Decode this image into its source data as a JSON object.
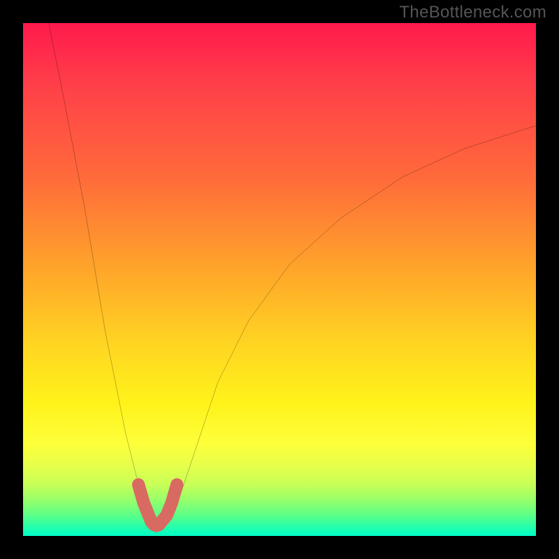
{
  "watermark": "TheBottleneck.com",
  "chart_data": {
    "type": "line",
    "title": "",
    "xlabel": "",
    "ylabel": "",
    "xlim": [
      0,
      100
    ],
    "ylim": [
      0,
      100
    ],
    "grid": false,
    "series": [
      {
        "name": "main-curve",
        "color": "#000000",
        "x": [
          5,
          8,
          12,
          16,
          18,
          20,
          22,
          24,
          25,
          26,
          27,
          28,
          30,
          32,
          34,
          38,
          44,
          52,
          62,
          74,
          86,
          100
        ],
        "y": [
          100,
          85,
          64,
          40,
          30,
          20,
          12,
          6,
          3,
          2,
          2,
          3,
          6,
          12,
          18,
          30,
          42,
          53,
          62,
          70,
          75.5,
          80
        ]
      },
      {
        "name": "threshold-band",
        "color": "#d86a62",
        "x": [
          22.5,
          23.5,
          24.5,
          25.0,
          25.5,
          26.0,
          26.5,
          27.0,
          28.0,
          29.0,
          30.0
        ],
        "y": [
          10.0,
          6.5,
          4.0,
          2.8,
          2.2,
          2.0,
          2.2,
          2.8,
          4.0,
          6.5,
          10.0
        ]
      }
    ],
    "gradient_stops": [
      {
        "pos": 0,
        "color": "#ff1a4d"
      },
      {
        "pos": 12,
        "color": "#ff3f49"
      },
      {
        "pos": 30,
        "color": "#ff6a3a"
      },
      {
        "pos": 48,
        "color": "#ffa52a"
      },
      {
        "pos": 63,
        "color": "#ffd622"
      },
      {
        "pos": 74,
        "color": "#fff21a"
      },
      {
        "pos": 82,
        "color": "#fdff3a"
      },
      {
        "pos": 86,
        "color": "#e8ff4a"
      },
      {
        "pos": 90,
        "color": "#c8ff58"
      },
      {
        "pos": 93,
        "color": "#96ff6a"
      },
      {
        "pos": 96,
        "color": "#5bff88"
      },
      {
        "pos": 98.5,
        "color": "#1effb0"
      },
      {
        "pos": 100,
        "color": "#00ffc8"
      }
    ]
  }
}
